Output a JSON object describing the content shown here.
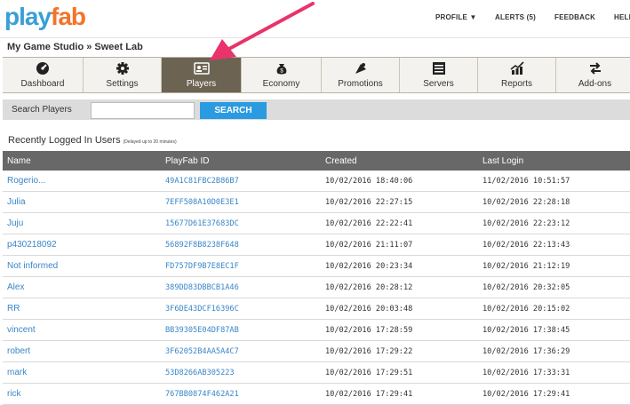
{
  "brand": {
    "logo_play": "play",
    "logo_fab": "fab",
    "color_play": "#3a9fd6",
    "color_fab": "#f2742a"
  },
  "topnav": {
    "profile": "PROFILE ▼",
    "alerts": "ALERTS (5)",
    "feedback": "FEEDBACK",
    "help": "HELP"
  },
  "breadcrumb": "My Game Studio » Sweet Lab",
  "tabs": [
    {
      "label": "Dashboard",
      "icon": "dashboard-icon"
    },
    {
      "label": "Settings",
      "icon": "gear-icon"
    },
    {
      "label": "Players",
      "icon": "players-card-icon",
      "active": true
    },
    {
      "label": "Economy",
      "icon": "money-bag-icon"
    },
    {
      "label": "Promotions",
      "icon": "megaphone-icon"
    },
    {
      "label": "Servers",
      "icon": "server-icon"
    },
    {
      "label": "Reports",
      "icon": "chart-icon"
    },
    {
      "label": "Add-ons",
      "icon": "swap-arrows-icon"
    }
  ],
  "search": {
    "label": "Search Players",
    "value": "",
    "placeholder": "",
    "button": "SEARCH"
  },
  "recent": {
    "title": "Recently Logged In Users",
    "note": "(Delayed up to 20 minutes)",
    "columns": [
      "Name",
      "PlayFab ID",
      "Created",
      "Last Login"
    ],
    "rows": [
      {
        "name": "Rogerio...",
        "id": "49A1C81FBC2B86B7",
        "created": "10/02/2016 18:40:06",
        "last": "11/02/2016 10:51:57"
      },
      {
        "name": "Julia",
        "id": "7EFF508A10D0E3E1",
        "created": "10/02/2016 22:27:15",
        "last": "10/02/2016 22:28:18"
      },
      {
        "name": "Juju",
        "id": "15677D61E37683DC",
        "created": "10/02/2016 22:22:41",
        "last": "10/02/2016 22:23:12"
      },
      {
        "name": "p430218092",
        "id": "56892F8B8238F648",
        "created": "10/02/2016 21:11:07",
        "last": "10/02/2016 22:13:43"
      },
      {
        "name": "Not informed",
        "id": "FD757DF9B7E8EC1F",
        "created": "10/02/2016 20:23:34",
        "last": "10/02/2016 21:12:19"
      },
      {
        "name": "Alex",
        "id": "389DD83DBBCB1A46",
        "created": "10/02/2016 20:28:12",
        "last": "10/02/2016 20:32:05"
      },
      {
        "name": "RR",
        "id": "3F6DE43DCF16396C",
        "created": "10/02/2016 20:03:48",
        "last": "10/02/2016 20:15:02"
      },
      {
        "name": "vincent",
        "id": "BB39305E04DF87AB",
        "created": "10/02/2016 17:28:59",
        "last": "10/02/2016 17:38:45"
      },
      {
        "name": "robert",
        "id": "3F62052B4AA5A4C7",
        "created": "10/02/2016 17:29:22",
        "last": "10/02/2016 17:36:29"
      },
      {
        "name": "mark",
        "id": "53D8266AB305223",
        "created": "10/02/2016 17:29:51",
        "last": "10/02/2016 17:33:31"
      },
      {
        "name": "rick",
        "id": "767BB0874F462A21",
        "created": "10/02/2016 17:29:41",
        "last": "10/02/2016 17:29:41"
      }
    ]
  },
  "colors": {
    "active_tab": "#6d6352",
    "header_row": "#686868",
    "link": "#3a86c8",
    "search_button": "#2a9be0",
    "annotation_arrow": "#e8336b"
  }
}
